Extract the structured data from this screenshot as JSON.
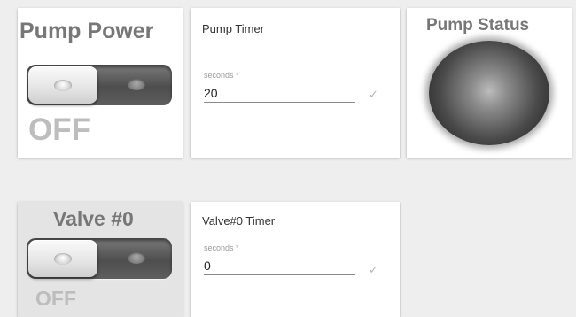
{
  "pump": {
    "power_title": "Pump Power",
    "power_state": "OFF",
    "power_on": false,
    "status_title": "Pump Status"
  },
  "pump_timer": {
    "title": "Pump Timer",
    "field_label": "seconds *",
    "value": "20",
    "confirm_icon": "checkmark-icon"
  },
  "valve0": {
    "title": "Valve #0",
    "state": "OFF",
    "on": false
  },
  "valve0_timer": {
    "title": "Valve#0 Timer",
    "field_label": "seconds *",
    "value": "0",
    "confirm_icon": "checkmark-icon"
  },
  "colors": {
    "background": "#eeeeee",
    "card": "#ffffff",
    "title_grey": "#777777",
    "off_text": "#bdbdbd"
  }
}
